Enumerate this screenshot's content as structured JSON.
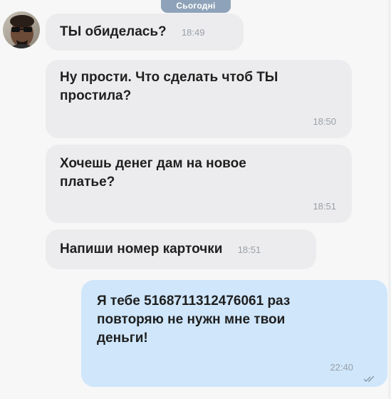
{
  "chat": {
    "date_label": "Сьогодні",
    "messages": [
      {
        "text": "ТЫ обиделась?",
        "time": "18:49"
      },
      {
        "text": "Ну прости. Что сделать чтоб ТЫ простила?",
        "time": "18:50"
      },
      {
        "text": "Хочешь денег дам на новое платье?",
        "time": "18:51"
      },
      {
        "text": "Напиши номер карточки",
        "time": "18:51"
      },
      {
        "text": "Я тебе 5168711312476061 раз повторяю не нужн мне твои деньги!",
        "time": "22:40"
      }
    ]
  },
  "colors": {
    "incoming_bubble": "#ececee",
    "outgoing_bubble": "#cfe6fb",
    "date_pill": "#8ea3b9",
    "timestamp": "#9aa0a8"
  },
  "icons": {
    "avatar": "contact-avatar",
    "read_receipt": "double-check-icon"
  }
}
